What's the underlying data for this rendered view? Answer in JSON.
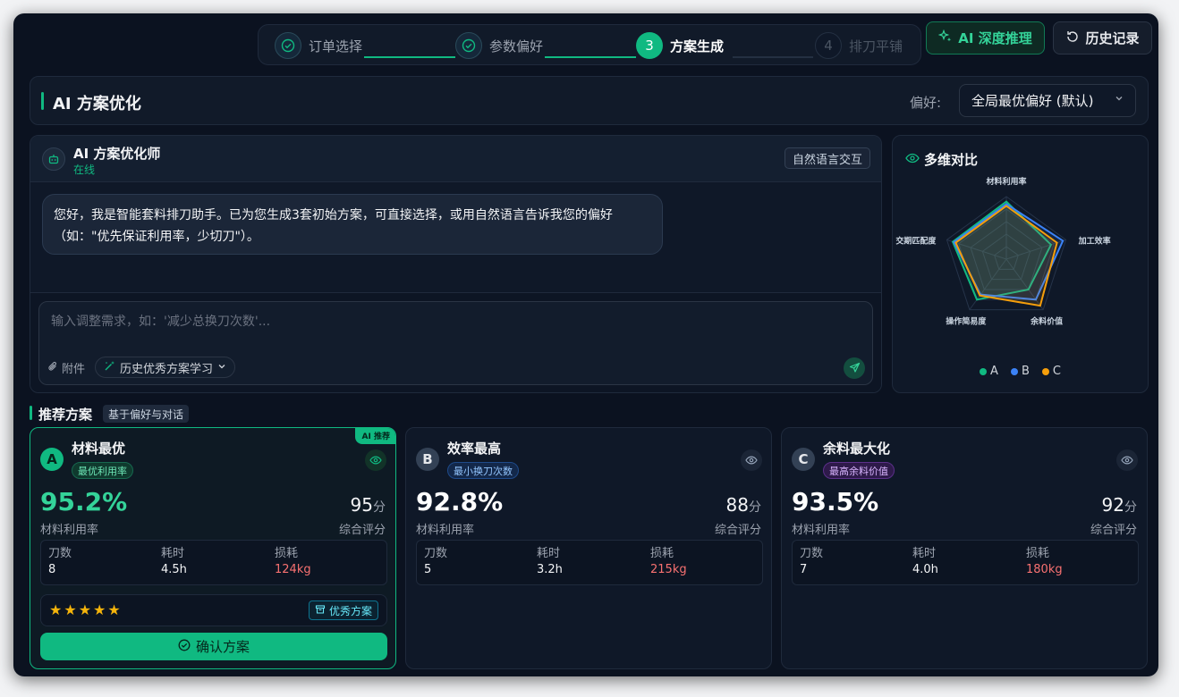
{
  "stepper": {
    "steps": [
      {
        "num": "1",
        "label": "订单选择",
        "state": "done"
      },
      {
        "num": "2",
        "label": "参数偏好",
        "state": "done"
      },
      {
        "num": "3",
        "label": "方案生成",
        "state": "active"
      },
      {
        "num": "4",
        "label": "排刀平铺",
        "state": "todo"
      }
    ]
  },
  "toolbar": {
    "ai_label": "AI 深度推理",
    "history_label": "历史记录"
  },
  "header": {
    "title": "AI 方案优化",
    "pref_label": "偏好:",
    "pref_value": "全局最优偏好 (默认)"
  },
  "chat": {
    "bot_name": "AI 方案优化师",
    "bot_status": "在线",
    "mode_tag": "自然语言交互",
    "message": "您好，我是智能套料排刀助手。已为您生成3套初始方案，可直接选择，或用自然语言告诉我您的偏好（如：\"优先保证利用率，少切刀\"）。",
    "input_placeholder": "输入调整需求，如：'减少总换刀次数'...",
    "attach_label": "附件",
    "learn_label": "历史优秀方案学习"
  },
  "radar": {
    "title": "多维对比",
    "axes": [
      "材料利用率",
      "加工效率",
      "余料价值",
      "操作简易度",
      "交期匹配度"
    ],
    "series": [
      {
        "name": "A",
        "color": "#10b981",
        "values": [
          92,
          75,
          60,
          80,
          90
        ]
      },
      {
        "name": "B",
        "color": "#3b82f6",
        "values": [
          88,
          95,
          80,
          70,
          88
        ]
      },
      {
        "name": "C",
        "color": "#f59e0b",
        "values": [
          85,
          85,
          92,
          72,
          85
        ]
      }
    ]
  },
  "recommend": {
    "title": "推荐方案",
    "tag": "基于偏好与对话"
  },
  "plans": [
    {
      "letter": "A",
      "name": "材料最优",
      "badge": "最优利用率",
      "rate": "95.2%",
      "rate_label": "材料利用率",
      "score": "95",
      "score_unit": "分",
      "score_label": "综合评分",
      "knife_label": "刀数",
      "knife": "8",
      "time_label": "耗时",
      "time": "4.5h",
      "loss_label": "损耗",
      "loss": "124kg",
      "ribbon": "AI 推荐",
      "rating": 5,
      "excellent_label": "优秀方案",
      "confirm_label": "确认方案"
    },
    {
      "letter": "B",
      "name": "效率最高",
      "badge": "最小换刀次数",
      "rate": "92.8%",
      "rate_label": "材料利用率",
      "score": "88",
      "score_unit": "分",
      "score_label": "综合评分",
      "knife_label": "刀数",
      "knife": "5",
      "time_label": "耗时",
      "time": "3.2h",
      "loss_label": "损耗",
      "loss": "215kg"
    },
    {
      "letter": "C",
      "name": "余料最大化",
      "badge": "最高余料价值",
      "rate": "93.5%",
      "rate_label": "材料利用率",
      "score": "92",
      "score_unit": "分",
      "score_label": "综合评分",
      "knife_label": "刀数",
      "knife": "7",
      "time_label": "耗时",
      "time": "4.0h",
      "loss_label": "损耗",
      "loss": "180kg"
    }
  ],
  "colors": {
    "accent": "#10b981",
    "bg": "#0b1220",
    "panel": "#0f1828",
    "loss": "#f87171"
  }
}
